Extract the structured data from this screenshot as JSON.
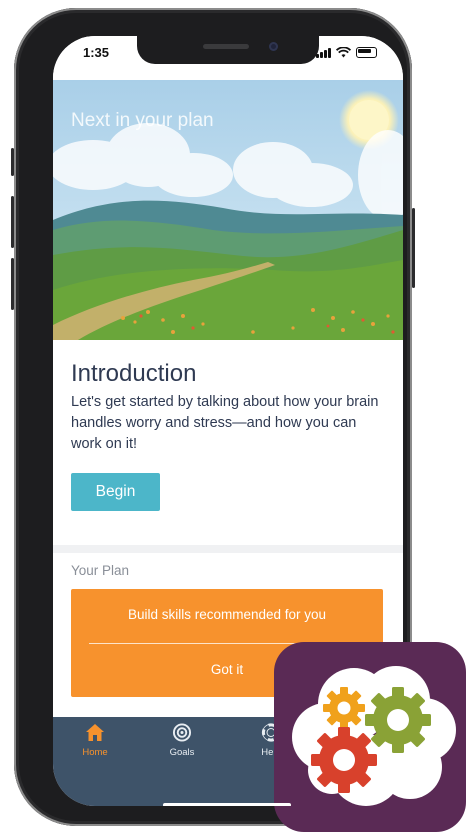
{
  "status_bar": {
    "time": "1:35"
  },
  "hero": {
    "title": "Next in your plan"
  },
  "intro": {
    "title": "Introduction",
    "body": "Let's get started by talking about how your brain handles worry and stress—and how you can work on it!",
    "button_label": "Begin"
  },
  "plan": {
    "label": "Your Plan",
    "card_text": "Build skills recommended for you",
    "action_label": "Got it"
  },
  "tabs": [
    {
      "label": "Home",
      "icon": "home-icon",
      "active": true
    },
    {
      "label": "Goals",
      "icon": "target-icon",
      "active": false
    },
    {
      "label": "Help",
      "icon": "lifebuoy-icon",
      "active": false
    }
  ],
  "colors": {
    "accent_orange": "#f7922d",
    "begin_teal": "#4cb6c9",
    "tabbar": "#3e5369",
    "text_dark": "#2f3a52",
    "app_icon_bg": "#5a2a55"
  }
}
